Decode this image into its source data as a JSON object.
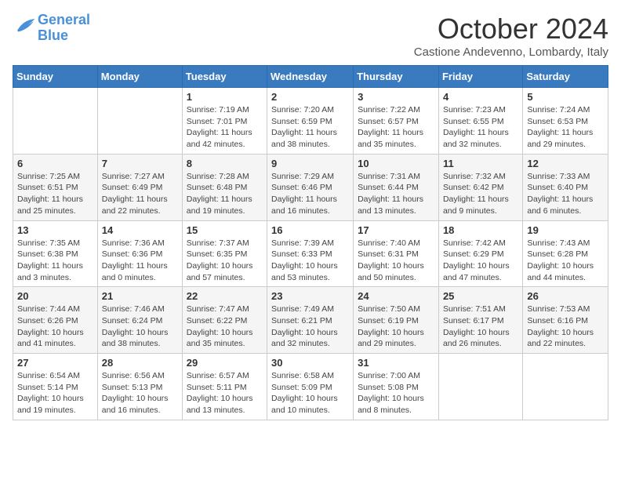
{
  "logo": {
    "line1": "General",
    "line2": "Blue"
  },
  "title": "October 2024",
  "subtitle": "Castione Andevenno, Lombardy, Italy",
  "headers": [
    "Sunday",
    "Monday",
    "Tuesday",
    "Wednesday",
    "Thursday",
    "Friday",
    "Saturday"
  ],
  "weeks": [
    [
      {
        "day": "",
        "info": ""
      },
      {
        "day": "",
        "info": ""
      },
      {
        "day": "1",
        "info": "Sunrise: 7:19 AM\nSunset: 7:01 PM\nDaylight: 11 hours and 42 minutes."
      },
      {
        "day": "2",
        "info": "Sunrise: 7:20 AM\nSunset: 6:59 PM\nDaylight: 11 hours and 38 minutes."
      },
      {
        "day": "3",
        "info": "Sunrise: 7:22 AM\nSunset: 6:57 PM\nDaylight: 11 hours and 35 minutes."
      },
      {
        "day": "4",
        "info": "Sunrise: 7:23 AM\nSunset: 6:55 PM\nDaylight: 11 hours and 32 minutes."
      },
      {
        "day": "5",
        "info": "Sunrise: 7:24 AM\nSunset: 6:53 PM\nDaylight: 11 hours and 29 minutes."
      }
    ],
    [
      {
        "day": "6",
        "info": "Sunrise: 7:25 AM\nSunset: 6:51 PM\nDaylight: 11 hours and 25 minutes."
      },
      {
        "day": "7",
        "info": "Sunrise: 7:27 AM\nSunset: 6:49 PM\nDaylight: 11 hours and 22 minutes."
      },
      {
        "day": "8",
        "info": "Sunrise: 7:28 AM\nSunset: 6:48 PM\nDaylight: 11 hours and 19 minutes."
      },
      {
        "day": "9",
        "info": "Sunrise: 7:29 AM\nSunset: 6:46 PM\nDaylight: 11 hours and 16 minutes."
      },
      {
        "day": "10",
        "info": "Sunrise: 7:31 AM\nSunset: 6:44 PM\nDaylight: 11 hours and 13 minutes."
      },
      {
        "day": "11",
        "info": "Sunrise: 7:32 AM\nSunset: 6:42 PM\nDaylight: 11 hours and 9 minutes."
      },
      {
        "day": "12",
        "info": "Sunrise: 7:33 AM\nSunset: 6:40 PM\nDaylight: 11 hours and 6 minutes."
      }
    ],
    [
      {
        "day": "13",
        "info": "Sunrise: 7:35 AM\nSunset: 6:38 PM\nDaylight: 11 hours and 3 minutes."
      },
      {
        "day": "14",
        "info": "Sunrise: 7:36 AM\nSunset: 6:36 PM\nDaylight: 11 hours and 0 minutes."
      },
      {
        "day": "15",
        "info": "Sunrise: 7:37 AM\nSunset: 6:35 PM\nDaylight: 10 hours and 57 minutes."
      },
      {
        "day": "16",
        "info": "Sunrise: 7:39 AM\nSunset: 6:33 PM\nDaylight: 10 hours and 53 minutes."
      },
      {
        "day": "17",
        "info": "Sunrise: 7:40 AM\nSunset: 6:31 PM\nDaylight: 10 hours and 50 minutes."
      },
      {
        "day": "18",
        "info": "Sunrise: 7:42 AM\nSunset: 6:29 PM\nDaylight: 10 hours and 47 minutes."
      },
      {
        "day": "19",
        "info": "Sunrise: 7:43 AM\nSunset: 6:28 PM\nDaylight: 10 hours and 44 minutes."
      }
    ],
    [
      {
        "day": "20",
        "info": "Sunrise: 7:44 AM\nSunset: 6:26 PM\nDaylight: 10 hours and 41 minutes."
      },
      {
        "day": "21",
        "info": "Sunrise: 7:46 AM\nSunset: 6:24 PM\nDaylight: 10 hours and 38 minutes."
      },
      {
        "day": "22",
        "info": "Sunrise: 7:47 AM\nSunset: 6:22 PM\nDaylight: 10 hours and 35 minutes."
      },
      {
        "day": "23",
        "info": "Sunrise: 7:49 AM\nSunset: 6:21 PM\nDaylight: 10 hours and 32 minutes."
      },
      {
        "day": "24",
        "info": "Sunrise: 7:50 AM\nSunset: 6:19 PM\nDaylight: 10 hours and 29 minutes."
      },
      {
        "day": "25",
        "info": "Sunrise: 7:51 AM\nSunset: 6:17 PM\nDaylight: 10 hours and 26 minutes."
      },
      {
        "day": "26",
        "info": "Sunrise: 7:53 AM\nSunset: 6:16 PM\nDaylight: 10 hours and 22 minutes."
      }
    ],
    [
      {
        "day": "27",
        "info": "Sunrise: 6:54 AM\nSunset: 5:14 PM\nDaylight: 10 hours and 19 minutes."
      },
      {
        "day": "28",
        "info": "Sunrise: 6:56 AM\nSunset: 5:13 PM\nDaylight: 10 hours and 16 minutes."
      },
      {
        "day": "29",
        "info": "Sunrise: 6:57 AM\nSunset: 5:11 PM\nDaylight: 10 hours and 13 minutes."
      },
      {
        "day": "30",
        "info": "Sunrise: 6:58 AM\nSunset: 5:09 PM\nDaylight: 10 hours and 10 minutes."
      },
      {
        "day": "31",
        "info": "Sunrise: 7:00 AM\nSunset: 5:08 PM\nDaylight: 10 hours and 8 minutes."
      },
      {
        "day": "",
        "info": ""
      },
      {
        "day": "",
        "info": ""
      }
    ]
  ]
}
